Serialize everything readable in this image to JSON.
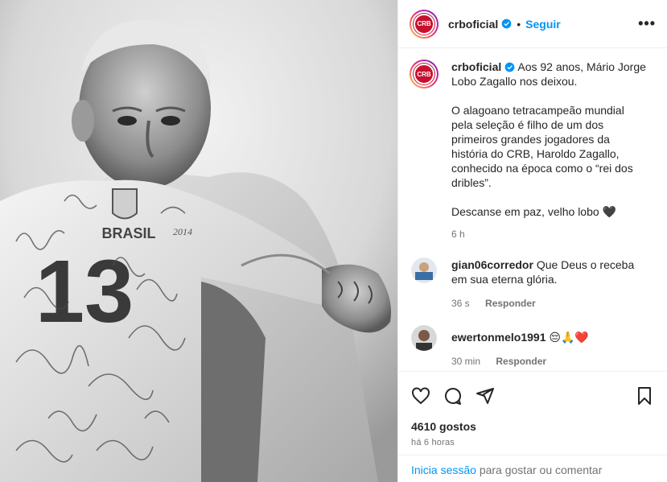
{
  "post": {
    "username": "crboficial",
    "follow_label": "Seguir",
    "dot": "•",
    "more": "•••",
    "badge_text": "CRB",
    "caption_lines": [
      "Aos 92 anos, Mário Jorge",
      "Lobo Zagallo nos deixou.",
      "",
      "O alagoano tetracampeão mundial",
      "pela seleção é filho de um dos",
      "primeiros grandes jogadores da",
      "história do CRB, Haroldo Zagallo,",
      "conhecido na época como o “rei dos",
      "dribles”.",
      "",
      "Descanse em paz, velho lobo 🖤"
    ],
    "caption_time": "6 h"
  },
  "comments": [
    {
      "username": "gian06corredor",
      "text": "Que Deus o receba em sua eterna glória.",
      "time": "36 s",
      "reply_label": "Responder"
    },
    {
      "username": "ewertonmelo1991",
      "text": "😔🙏❤️",
      "time": "30 min",
      "reply_label": "Responder"
    }
  ],
  "actions": {
    "likes": "4610 gostos",
    "time": "há 6 horas",
    "icons": [
      "heart-icon",
      "comment-icon",
      "share-icon",
      "bookmark-icon"
    ]
  },
  "login": {
    "link": "Inicia sessão",
    "rest": " para gostar ou comentar"
  },
  "photo": {
    "shirt_text": "BRASIL",
    "shirt_number": "13",
    "signature_year": "2014"
  },
  "colors": {
    "accent": "#0095f6",
    "brand": "#c8102e",
    "muted": "#737373",
    "text": "#262626"
  }
}
